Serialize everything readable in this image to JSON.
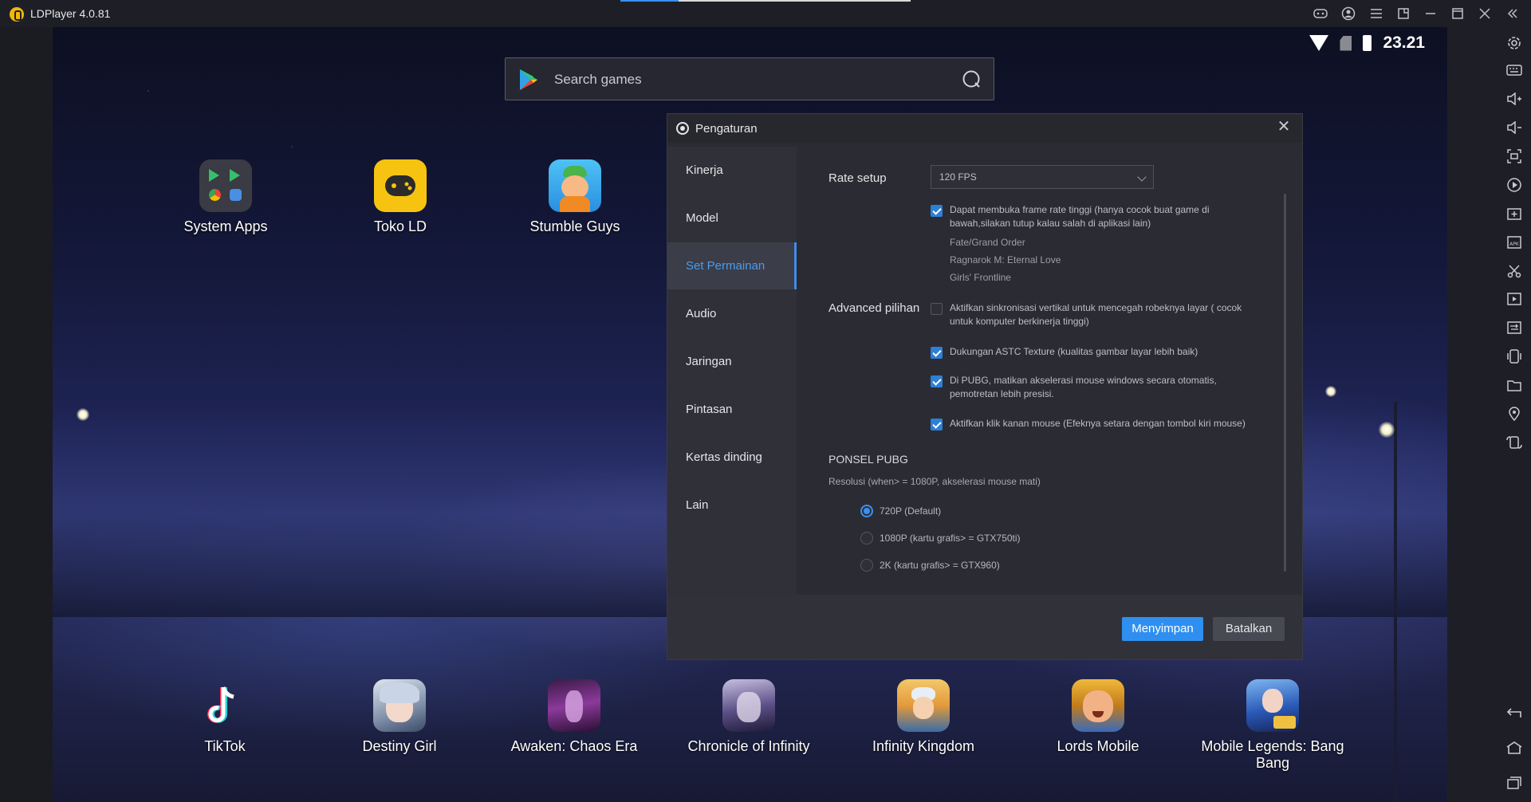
{
  "window": {
    "title": "LDPlayer 4.0.81",
    "download_progress": 0.2
  },
  "status_bar": {
    "time": "23.21"
  },
  "search": {
    "placeholder": "Search games"
  },
  "top_apps": [
    {
      "label": "System Apps"
    },
    {
      "label": "Toko LD"
    },
    {
      "label": "Stumble Guys"
    }
  ],
  "bottom_apps": [
    {
      "label": "TikTok"
    },
    {
      "label": "Destiny Girl"
    },
    {
      "label": "Awaken: Chaos Era"
    },
    {
      "label": "Chronicle of Infinity"
    },
    {
      "label": "Infinity Kingdom"
    },
    {
      "label": "Lords Mobile"
    },
    {
      "label": "Mobile Legends: Bang Bang"
    }
  ],
  "dialog": {
    "title": "Pengaturan",
    "nav": [
      {
        "label": "Kinerja"
      },
      {
        "label": "Model"
      },
      {
        "label": "Set Permainan"
      },
      {
        "label": "Audio"
      },
      {
        "label": "Jaringan"
      },
      {
        "label": "Pintasan"
      },
      {
        "label": "Kertas dinding"
      },
      {
        "label": "Lain"
      }
    ],
    "active_nav": "Set Permainan",
    "rate_setup": {
      "label": "Rate setup",
      "value": "120 FPS",
      "high_fps_text": "Dapat membuka frame rate tinggi  (hanya cocok buat game di bawah,silakan tutup kalau salah di aplikasi lain)",
      "high_fps_checked": true,
      "games": [
        "Fate/Grand Order",
        "Ragnarok M: Eternal Love",
        "Girls' Frontline"
      ]
    },
    "advanced": {
      "label": "Advanced pilihan",
      "options": [
        {
          "text": "Aktifkan sinkronisasi vertikal untuk mencegah robeknya layar   ( cocok untuk komputer berkinerja tinggi)",
          "checked": false
        },
        {
          "text": "Dukungan ASTC Texture   (kualitas gambar layar  lebih baik)",
          "checked": true
        },
        {
          "text": "Di PUBG, matikan akselerasi mouse windows secara otomatis, pemotretan lebih presisi.",
          "checked": true
        },
        {
          "text": "Aktifkan klik kanan mouse (Efeknya setara dengan tombol kiri mouse)",
          "checked": true
        }
      ]
    },
    "pubg": {
      "section": "PONSEL PUBG",
      "note": "Resolusi   (when> = 1080P, akselerasi mouse mati)",
      "resolutions": [
        {
          "text": "720P   (Default)",
          "selected": true
        },
        {
          "text": "1080P   (kartu grafis> = GTX750ti)",
          "selected": false
        },
        {
          "text": "2K   (kartu grafis> = GTX960)",
          "selected": false
        }
      ]
    },
    "buttons": {
      "save": "Menyimpan",
      "cancel": "Batalkan"
    }
  },
  "colors": {
    "accent": "#2f8ff0",
    "dialog_bg": "#2b2c33",
    "titlebar_bg": "#1e1f26"
  },
  "icons": {
    "right_sidebar": [
      "settings-icon",
      "keyboard-icon",
      "volume-up-icon",
      "volume-down-icon",
      "screenshot-icon",
      "record-icon",
      "add-instance-icon",
      "apk-icon",
      "cut-icon",
      "video-icon",
      "sync-icon",
      "shake-icon",
      "folder-icon",
      "location-icon",
      "rotate-icon"
    ],
    "right_sidebar_bottom": [
      "back-icon",
      "home-icon",
      "recent-apps-icon"
    ],
    "titlebar": [
      "gamepad-icon",
      "account-icon",
      "menu-icon",
      "pin-icon",
      "minimize-icon",
      "maximize-icon",
      "close-icon",
      "collapse-icon"
    ]
  }
}
